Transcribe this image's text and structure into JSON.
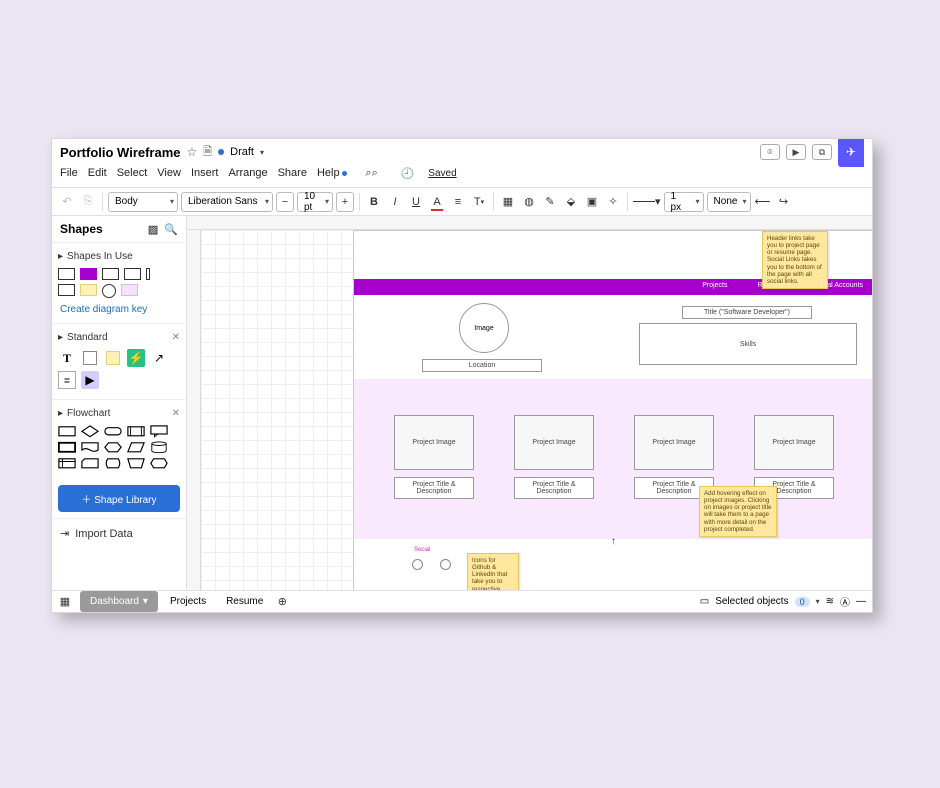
{
  "title": "Portfolio Wireframe",
  "status": {
    "label": "Draft",
    "saved": "Saved"
  },
  "menu": {
    "file": "File",
    "edit": "Edit",
    "select": "Select",
    "view": "View",
    "insert": "Insert",
    "arrange": "Arrange",
    "share": "Share",
    "help": "Help"
  },
  "toolbar": {
    "style_select": "Body",
    "font_select": "Liberation Sans",
    "font_size": "10 pt",
    "stroke_width": "1 px",
    "line_end": "None"
  },
  "sidebar": {
    "title": "Shapes",
    "in_use": "Shapes In Use",
    "create_key": "Create diagram key",
    "standard": "Standard",
    "flowchart": "Flowchart",
    "shape_lib": "Shape Library",
    "import": "Import Data"
  },
  "canvas": {
    "header_links": [
      "Projects",
      "Resume",
      "Social Accounts"
    ],
    "avatar": "Image",
    "location": "Location",
    "title_box": "Title (\"Software Developer\")",
    "skills": "Skills",
    "project_image": "Project Image",
    "project_title": "Project Title & Description",
    "social_label": "Social",
    "note_header": "Header links take you to project page or resume page. Social Links takes you to the bottom of the page with all social links.",
    "note_hover": "Add hovering effect on project images. Clicking on images or project title will take them to a page with more detail on the project completed.",
    "note_icons": "Icons for Github & LinkedIn that take you to respective profile."
  },
  "footer": {
    "tabs": [
      "Dashboard",
      "Projects",
      "Resume"
    ],
    "selected": "Selected objects",
    "count": "0"
  }
}
